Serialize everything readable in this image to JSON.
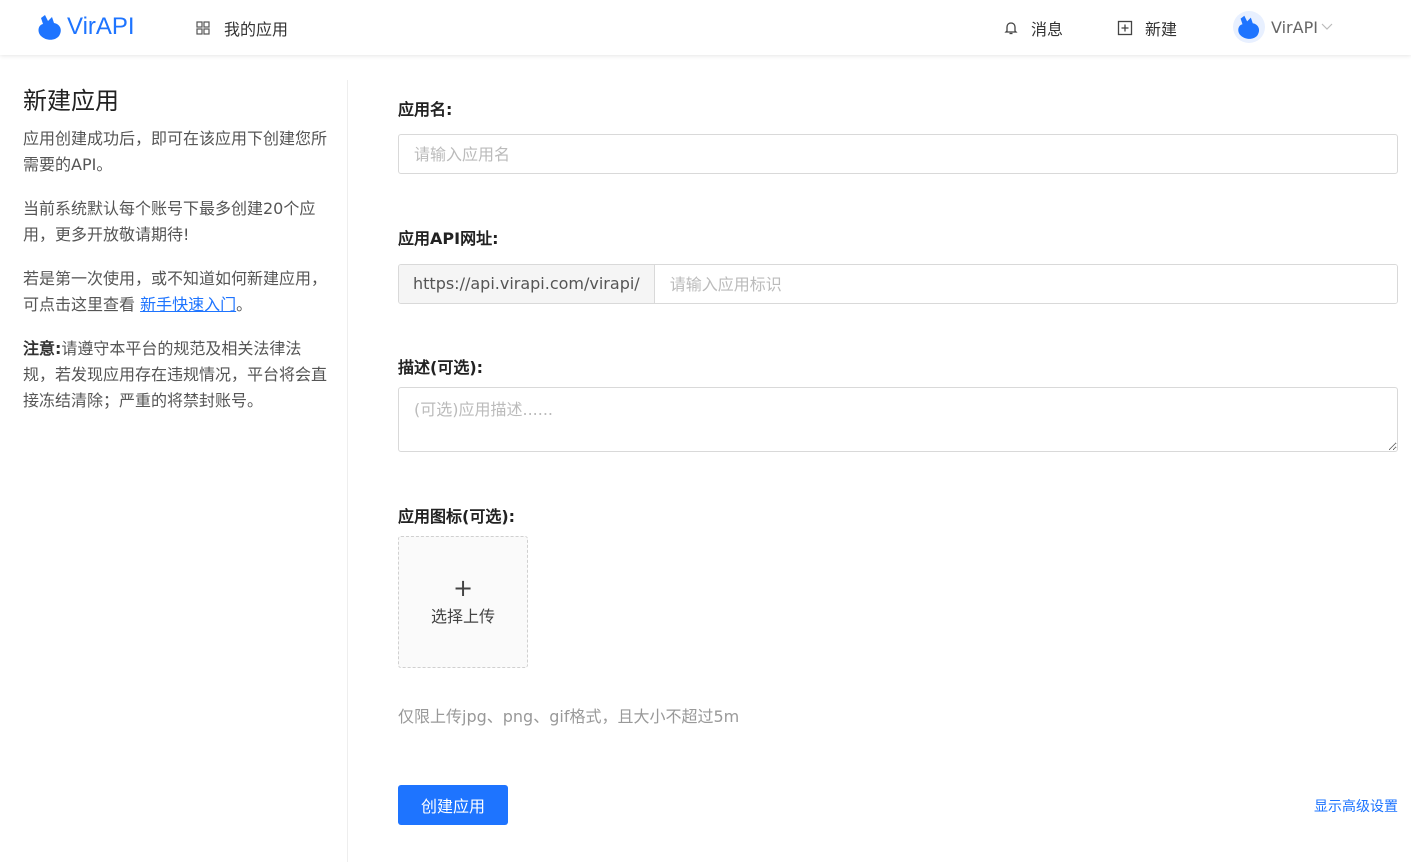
{
  "header": {
    "brand": "VirAPI",
    "nav_apps": "我的应用",
    "nav_messages": "消息",
    "nav_new": "新建",
    "user_name": "VirAPI"
  },
  "left": {
    "title": "新建应用",
    "para1": "应用创建成功后，即可在该应用下创建您所需要的API。",
    "para2": "当前系统默认每个账号下最多创建20个应用，更多开放敬请期待!",
    "para3_before": "若是第一次使用，或不知道如何新建应用，可点击这里查看 ",
    "para3_link": "新手快速入门",
    "para3_after": "。",
    "note_label": "注意:",
    "note_text": "请遵守本平台的规范及相关法律法规，若发现应用存在违规情况，平台将会直接冻结清除；严重的将禁封账号。"
  },
  "form": {
    "name_label": "应用名:",
    "name_placeholder": "请输入应用名",
    "api_label": "应用API网址:",
    "api_prefix": "https://api.virapi.com/virapi/",
    "api_placeholder": "请输入应用标识",
    "desc_label": "描述(可选):",
    "desc_placeholder": "(可选)应用描述......",
    "icon_label": "应用图标(可选):",
    "upload_plus": "+",
    "upload_text": "选择上传",
    "upload_hint": "仅限上传jpg、png、gif格式，且大小不超过5m",
    "create_button": "创建应用",
    "advanced_link": "显示高级设置"
  },
  "colors": {
    "accent": "#1e74ff"
  }
}
